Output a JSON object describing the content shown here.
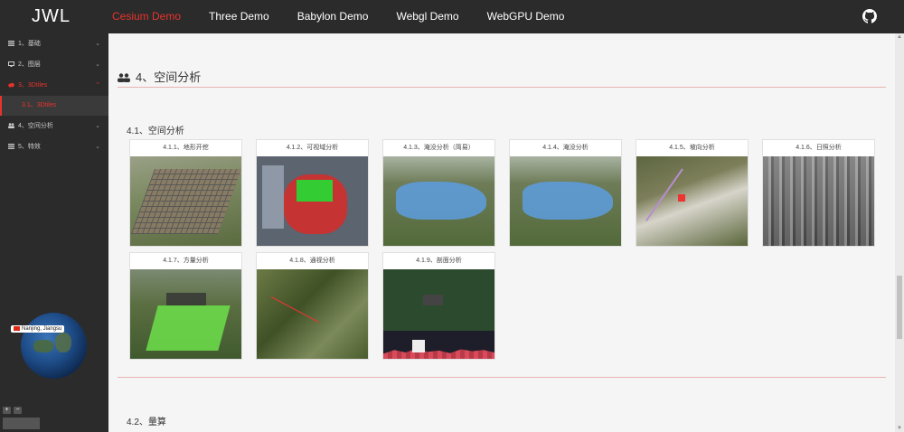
{
  "brand": "JWL",
  "topnav": [
    "Cesium Demo",
    "Three Demo",
    "Babylon Demo",
    "Webgl Demo",
    "WebGPU Demo"
  ],
  "sidebar": {
    "items": [
      {
        "label": "1、基础"
      },
      {
        "label": "2、图层"
      },
      {
        "label": "3、3Dtiles",
        "active": true
      },
      {
        "label": "4、空间分析"
      },
      {
        "label": "5、特效"
      }
    ],
    "sub_item": "3.1、3Dtiles",
    "location_tag": "Nanjing, Jiangsu"
  },
  "main": {
    "section_title": "4、空间分析",
    "sub_title": "4.1、空间分析",
    "cards": [
      {
        "caption": "4.1.1、地形开挖"
      },
      {
        "caption": "4.1.2、可视域分析"
      },
      {
        "caption": "4.1.3、淹没分析（简易）"
      },
      {
        "caption": "4.1.4、淹没分析"
      },
      {
        "caption": "4.1.5、坡向分析"
      },
      {
        "caption": "4.1.6、日照分析"
      },
      {
        "caption": "4.1.7、方量分析"
      },
      {
        "caption": "4.1.8、通视分析"
      },
      {
        "caption": "4.1.9、剖面分析"
      }
    ],
    "sub_title2": "4.2、量算"
  },
  "colors": {
    "accent": "#e8332c",
    "topbar": "#2b2b2b"
  }
}
